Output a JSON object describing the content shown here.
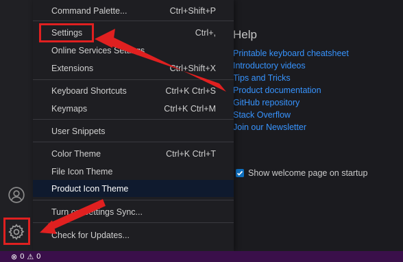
{
  "menu": {
    "items": [
      {
        "label": "Command Palette...",
        "shortcut": "Ctrl+Shift+P"
      },
      {
        "label": "Settings",
        "shortcut": "Ctrl+,"
      },
      {
        "label": "Online Services Settings",
        "shortcut": ""
      },
      {
        "label": "Extensions",
        "shortcut": "Ctrl+Shift+X"
      },
      {
        "label": "Keyboard Shortcuts",
        "shortcut": "Ctrl+K Ctrl+S"
      },
      {
        "label": "Keymaps",
        "shortcut": "Ctrl+K Ctrl+M"
      },
      {
        "label": "User Snippets",
        "shortcut": ""
      },
      {
        "label": "Color Theme",
        "shortcut": "Ctrl+K Ctrl+T"
      },
      {
        "label": "File Icon Theme",
        "shortcut": ""
      },
      {
        "label": "Product Icon Theme",
        "shortcut": ""
      },
      {
        "label": "Turn on Settings Sync...",
        "shortcut": ""
      },
      {
        "label": "Check for Updates...",
        "shortcut": ""
      }
    ]
  },
  "help": {
    "title": "Help",
    "links": [
      "Printable keyboard cheatsheet",
      "Introductory videos",
      "Tips and Tricks",
      "Product documentation",
      "GitHub repository",
      "Stack Overflow",
      "Join our Newsletter"
    ]
  },
  "welcome": {
    "show_on_startup_label": "Show welcome page on startup",
    "show_on_startup_checked": true
  },
  "status_bar": {
    "errors": "0",
    "warnings": "0"
  },
  "activity_bar": {
    "icons": [
      "account-icon",
      "gear-icon"
    ]
  },
  "colors": {
    "link": "#3794ff",
    "status_bar": "#3a0f4a",
    "annotation": "#e02020",
    "active_item_bg": "#0f1a2e"
  }
}
